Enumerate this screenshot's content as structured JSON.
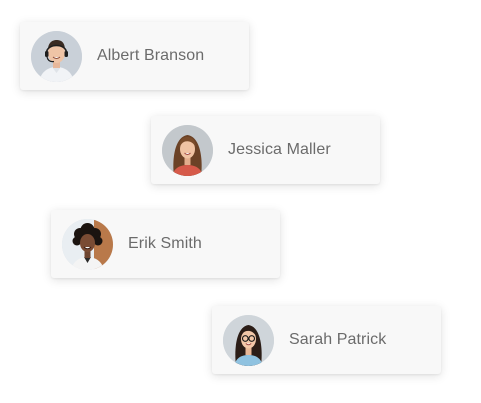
{
  "contacts": [
    {
      "name": "Albert Branson",
      "avatar_icon": "person-avatar-man-headset"
    },
    {
      "name": "Jessica Maller",
      "avatar_icon": "person-avatar-woman-long-hair"
    },
    {
      "name": "Erik Smith",
      "avatar_icon": "person-avatar-man-curly-hair"
    },
    {
      "name": "Sarah Patrick",
      "avatar_icon": "person-avatar-woman-glasses"
    }
  ]
}
